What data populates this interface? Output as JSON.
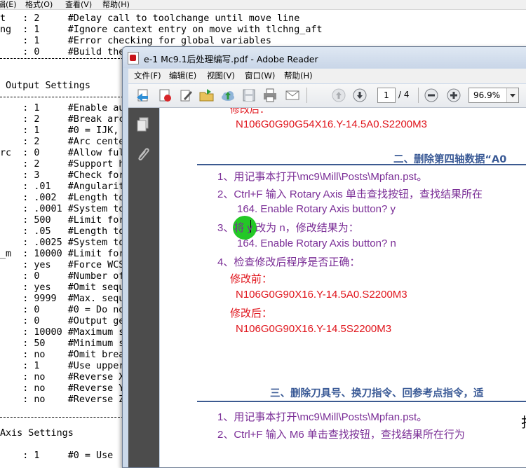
{
  "editor": {
    "menu": [
      "辑(E)",
      "格式(O)",
      "查看(V)",
      "帮助(H)"
    ],
    "lines": [
      "t   : 2     #Delay call to toolchange until move line",
      "ng  : 1     #Ignore cantext entry on move with tlchng_aft",
      "    : 1     #Error checking for global variables",
      "    : 0     #Build the",
      "",
      "",
      " Output Settings",
      "",
      "    : 1     #Enable aut",
      "    : 2     #Break arcs",
      "    : 1     #0 = IJK, 1",
      "    : 2     #Arc center",
      "rc  : 0     #Allow full",
      "    : 2     #Support he",
      "    : 3     #Check for",
      "    : .01   #Angularity",
      "    : .002  #Length tol",
      "    : .0001 #System tol",
      "    : 500   #Limit for",
      "    : .05   #Length tol",
      "    : .0025 #System tol",
      "_m  : 10000 #Limit for",
      "    : yes   #Force WCS",
      "    : 0     #Number of",
      "    : yes   #Omit seque",
      "    : 9999  #Max. seque",
      "    : 0     #0 = Do not",
      "    : 0     #Output gea",
      "    : 10000 #Maximum sp",
      "    : 50    #Minimum sp",
      "    : no    #Omit break",
      "    : 1     #Use upperc",
      "    : no    #Reverse X",
      "    : no    #Reverse Y",
      "    : no    #Reverse Z",
      "",
      "",
      "Axis Settings",
      "",
      "    : 1     #0 = Use"
    ]
  },
  "reader": {
    "title": "e-1 Mc9.1后处理编写.pdf - Adobe Reader",
    "menu": [
      "文件(F)",
      "编辑(E)",
      "视图(V)",
      "窗口(W)",
      "帮助(H)"
    ],
    "page_current": "1",
    "page_total": "/ 4",
    "zoom": "96.9%",
    "content": {
      "top_label": "修改后：",
      "top_code": "N106G0G90G54X16.Y-14.5A0.S2200M3",
      "section2_heading": "二、删除第四轴数据“A0",
      "step1": "1、用记事本打开\\mc9\\Mill\\Posts\\Mpfan.pst。",
      "step2": "2、Ctrl+F 输入 Rotary Axis 单击查找按钮，查找结果所在",
      "step2_result": "164. Enable Rotary Axis button? y",
      "step3": "3、将 y 改为 n，修改结果为：",
      "step3_result": "164. Enable Rotary Axis button? n",
      "step4": "4、检查修改后程序是否正确：",
      "before_label": "修改前：",
      "before_code": "N106G0G90X16.Y-14.5A0.S2200M3",
      "after_label": "修改后：",
      "after_code": "N106G0G90X16.Y-14.5S2200M3",
      "section3_heading": "三、删除刀具号、换刀指令、回参考点指令，适",
      "step3_1": "1、用记事本打开\\mc9\\Mill\\Posts\\Mpfan.pst。",
      "step3_2": "2、Ctrl+F 输入 M6 单击查找按钮，查找结果所在行为",
      "side_char": "打"
    }
  }
}
